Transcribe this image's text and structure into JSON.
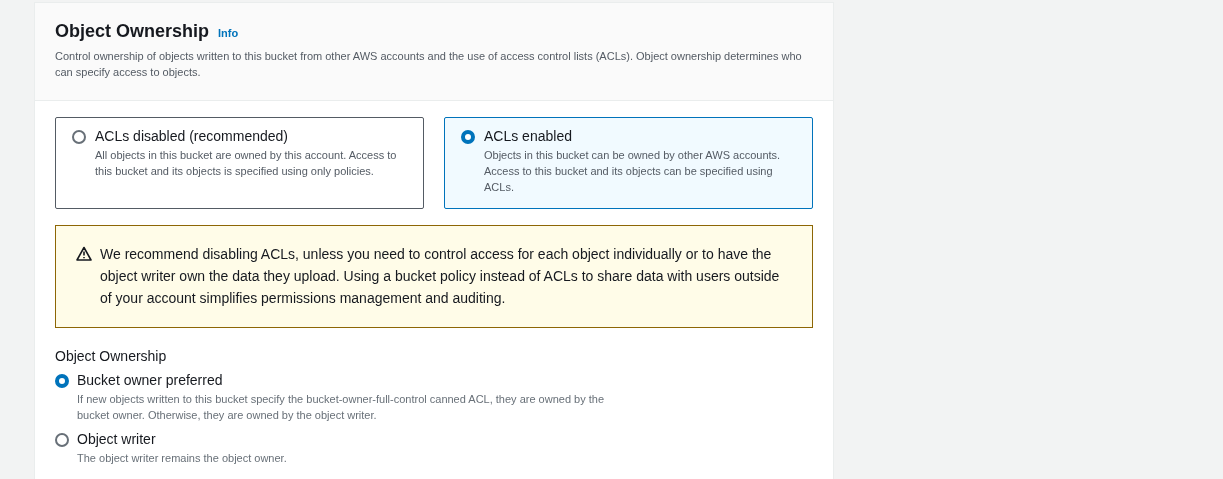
{
  "panel": {
    "title": "Object Ownership",
    "info_link": "Info",
    "description": "Control ownership of objects written to this bucket from other AWS accounts and the use of access control lists (ACLs). Object ownership determines who can specify access to objects."
  },
  "tiles": [
    {
      "label": "ACLs disabled (recommended)",
      "description": "All objects in this bucket are owned by this account. Access to this bucket and its objects is specified using only policies.",
      "selected": false
    },
    {
      "label": "ACLs enabled",
      "description": "Objects in this bucket can be owned by other AWS accounts. Access to this bucket and its objects can be specified using ACLs.",
      "selected": true
    }
  ],
  "warning": {
    "text": "We recommend disabling ACLs, unless you need to control access for each object individually or to have the object writer own the data they upload. Using a bucket policy instead of ACLs to share data with users outside of your account simplifies permissions management and auditing."
  },
  "ownership": {
    "label": "Object Ownership",
    "options": [
      {
        "label": "Bucket owner preferred",
        "description": "If new objects written to this bucket specify the bucket-owner-full-control canned ACL, they are owned by the bucket owner. Otherwise, they are owned by the object writer.",
        "selected": true
      },
      {
        "label": "Object writer",
        "description": "The object writer remains the object owner.",
        "selected": false
      }
    ]
  }
}
